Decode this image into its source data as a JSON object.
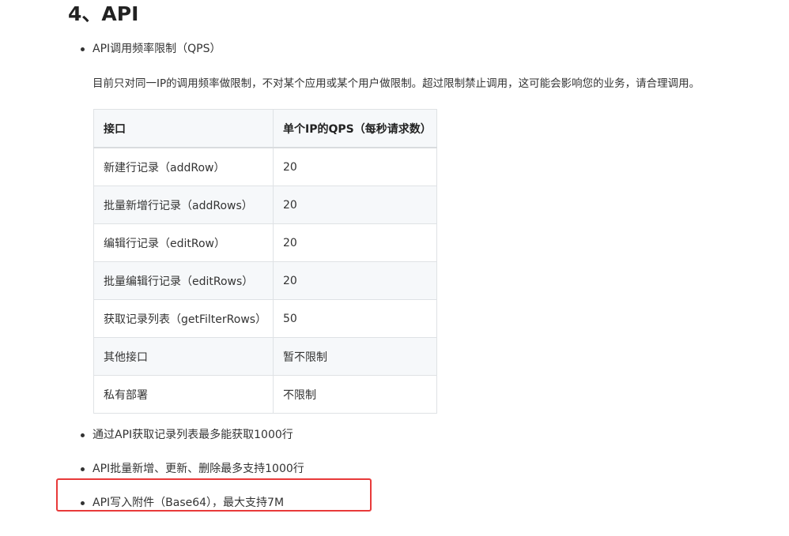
{
  "section": {
    "title": "4、API"
  },
  "bullets": [
    {
      "text": "API调用频率限制（QPS）"
    },
    {
      "text": "通过API获取记录列表最多能获取1000行"
    },
    {
      "text": "API批量新增、更新、删除最多支持1000行"
    },
    {
      "text": "API写入附件（Base64），最大支持7M"
    }
  ],
  "qps_description": "目前只对同一IP的调用频率做限制，不对某个应用或某个用户做限制。超过限制禁止调用，这可能会影响您的业务，请合理调用。",
  "qps_table": {
    "headers": [
      "接口",
      "单个IP的QPS（每秒请求数）"
    ],
    "rows": [
      [
        "新建行记录（addRow）",
        "20"
      ],
      [
        "批量新增行记录（addRows）",
        "20"
      ],
      [
        "编辑行记录（editRow）",
        "20"
      ],
      [
        "批量编辑行记录（editRows）",
        "20"
      ],
      [
        "获取记录列表（getFilterRows）",
        "50"
      ],
      [
        "其他接口",
        "暂不限制"
      ],
      [
        "私有部署",
        "不限制"
      ]
    ]
  },
  "highlight_color": "#e83a3a"
}
